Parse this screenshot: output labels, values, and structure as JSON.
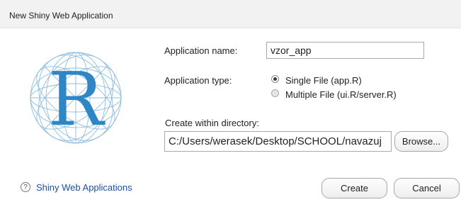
{
  "window": {
    "title": "New Shiny Web Application"
  },
  "logo": {
    "letter": "R",
    "color": "#2f86c4"
  },
  "form": {
    "app_name_label": "Application name:",
    "app_name_value": "vzor_app",
    "app_type_label": "Application type:",
    "app_type_options": [
      {
        "label": "Single File (app.R)",
        "selected": true
      },
      {
        "label": "Multiple File (ui.R/server.R)",
        "selected": false
      }
    ],
    "directory_label": "Create within directory:",
    "directory_value": "C:/Users/werasek/Desktop/SCHOOL/navazuj",
    "browse_label": "Browse..."
  },
  "footer": {
    "help_glyph": "?",
    "help_link": "Shiny Web Applications",
    "create_label": "Create",
    "cancel_label": "Cancel"
  },
  "colors": {
    "link": "#1a4fa3",
    "titlebar": "#f2f2f2",
    "logo": "#2f86c4"
  }
}
